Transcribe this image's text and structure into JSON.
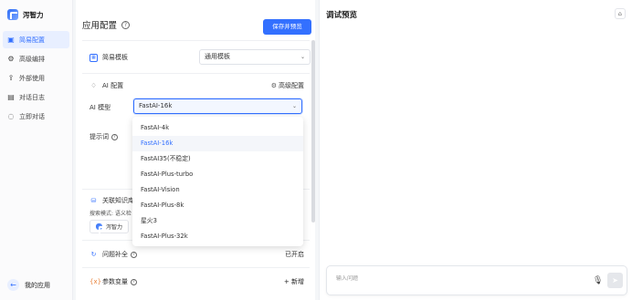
{
  "app": {
    "name": "泻智力"
  },
  "sidebar": {
    "items": [
      {
        "label": "简易配置",
        "icon": "layout-icon",
        "active": true
      },
      {
        "label": "高级编排",
        "icon": "settings-icon",
        "active": false
      },
      {
        "label": "外部使用",
        "icon": "share-icon",
        "active": false
      },
      {
        "label": "对话日志",
        "icon": "chat-log-icon",
        "active": false
      },
      {
        "label": "立即对话",
        "icon": "chat-icon",
        "active": false
      }
    ],
    "bottom_label": "我的应用"
  },
  "config": {
    "title": "应用配置",
    "save_label": "保存并预览",
    "template": {
      "label": "简易模板",
      "value": "通用模板"
    },
    "ai": {
      "label": "AI 配置",
      "advanced_label": "高级配置",
      "model_label": "AI 模型",
      "model_value": "FastAI-16k",
      "prompt_label": "提示词"
    },
    "model_options": [
      "FastAI-4k",
      "FastAI-16k",
      "FastAI35(不稳定)",
      "FastAI-Plus-turbo",
      "FastAI-Vision",
      "FastAI-Plus-8k",
      "星火3",
      "FastAI-Plus-32k"
    ],
    "knowledge": {
      "label": "关联知识库",
      "mode_text": "搜索模式: 语义检",
      "chip_label": "泻智力"
    },
    "question_completion": {
      "label": "问题补全",
      "status": "已开启"
    },
    "variables": {
      "label": "参数变量",
      "add_label": "+ 新增"
    }
  },
  "preview": {
    "title": "调试预览",
    "input_placeholder": "输入问题"
  },
  "colors": {
    "accent": "#3370ff",
    "active_bg": "#e8efff"
  }
}
